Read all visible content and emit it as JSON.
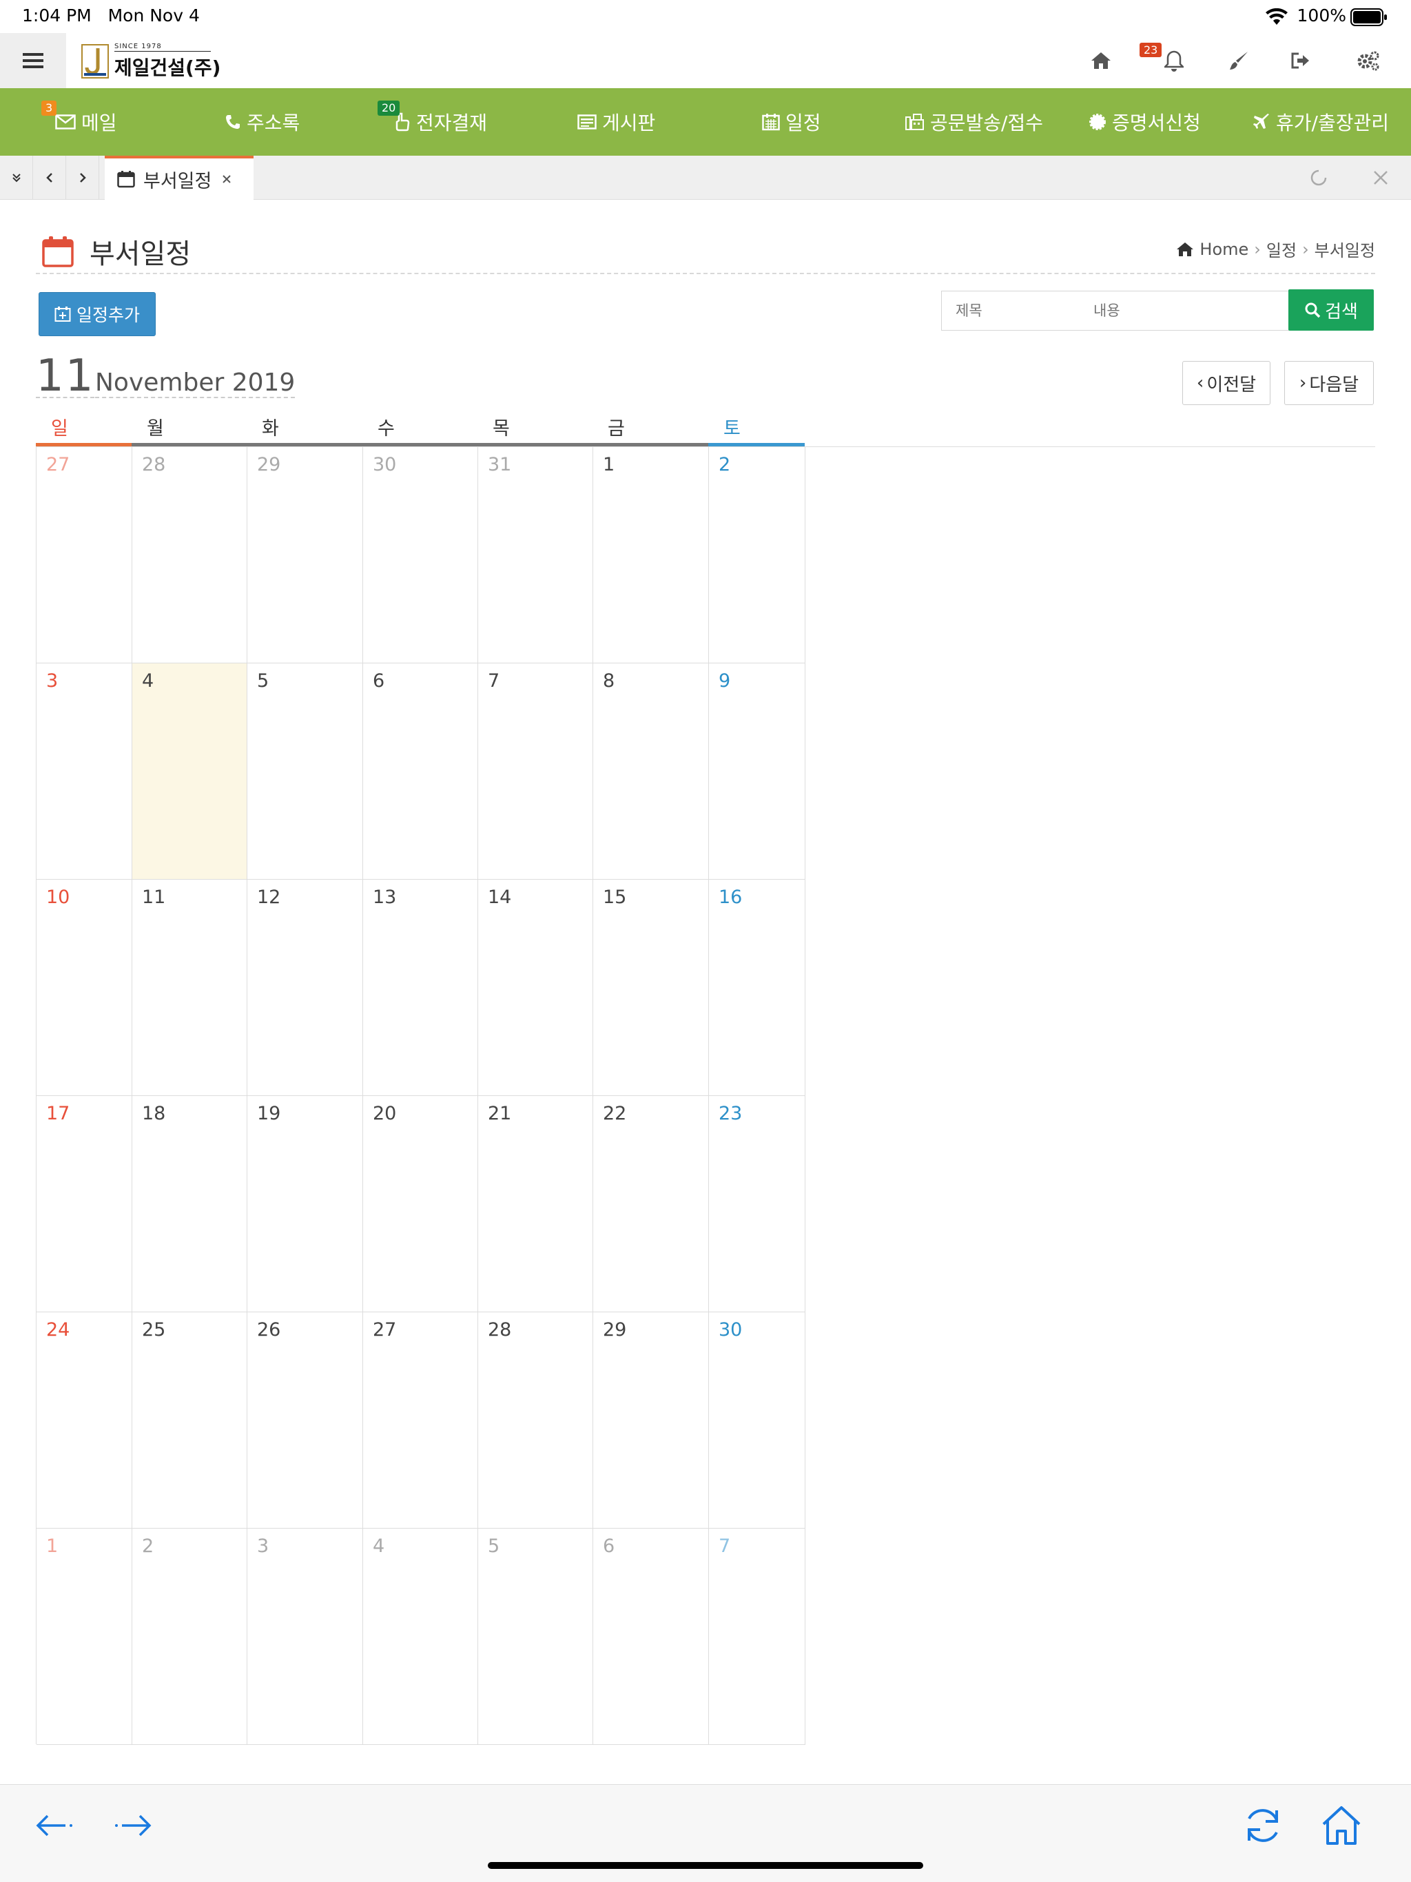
{
  "status_bar": {
    "time": "1:04 PM",
    "date": "Mon Nov 4",
    "battery": "100%"
  },
  "header": {
    "logo_since": "SINCE 1978",
    "logo_name": "제일건설(주)",
    "notification_count": "23"
  },
  "nav": {
    "items": [
      {
        "label": "메일",
        "icon": "mail-icon",
        "badge": "3",
        "badge_color": "#f08c1e"
      },
      {
        "label": "주소록",
        "icon": "phone-icon"
      },
      {
        "label": "전자결재",
        "icon": "approval-icon",
        "badge": "20",
        "badge_color": "#1a8a3c"
      },
      {
        "label": "게시판",
        "icon": "board-icon"
      },
      {
        "label": "일정",
        "icon": "calendar-icon"
      },
      {
        "label": "공문발송/접수",
        "icon": "fax-icon"
      },
      {
        "label": "증명서신청",
        "icon": "certificate-icon"
      },
      {
        "label": "휴가/출장관리",
        "icon": "plane-icon"
      }
    ]
  },
  "tabs": {
    "active_label": "부서일정"
  },
  "page": {
    "title": "부서일정",
    "breadcrumb": [
      "Home",
      "일정",
      "부서일정"
    ],
    "add_button": "일정추가",
    "search_title_placeholder": "제목",
    "search_content_placeholder": "내용",
    "search_button": "검색",
    "month_number": "11",
    "month_name": "November 2019",
    "prev_button": "이전달",
    "next_button": "다음달"
  },
  "calendar": {
    "weekdays": [
      "일",
      "월",
      "화",
      "수",
      "목",
      "금",
      "토"
    ],
    "today": "4",
    "weeks": [
      [
        {
          "d": "27",
          "o": true
        },
        {
          "d": "28",
          "o": true
        },
        {
          "d": "29",
          "o": true
        },
        {
          "d": "30",
          "o": true
        },
        {
          "d": "31",
          "o": true
        },
        {
          "d": "1"
        },
        {
          "d": "2"
        }
      ],
      [
        {
          "d": "3"
        },
        {
          "d": "4",
          "t": true
        },
        {
          "d": "5"
        },
        {
          "d": "6"
        },
        {
          "d": "7"
        },
        {
          "d": "8"
        },
        {
          "d": "9"
        }
      ],
      [
        {
          "d": "10"
        },
        {
          "d": "11"
        },
        {
          "d": "12"
        },
        {
          "d": "13"
        },
        {
          "d": "14"
        },
        {
          "d": "15"
        },
        {
          "d": "16"
        }
      ],
      [
        {
          "d": "17"
        },
        {
          "d": "18"
        },
        {
          "d": "19"
        },
        {
          "d": "20"
        },
        {
          "d": "21"
        },
        {
          "d": "22"
        },
        {
          "d": "23"
        }
      ],
      [
        {
          "d": "24"
        },
        {
          "d": "25"
        },
        {
          "d": "26"
        },
        {
          "d": "27"
        },
        {
          "d": "28"
        },
        {
          "d": "29"
        },
        {
          "d": "30"
        }
      ],
      [
        {
          "d": "1",
          "o": true
        },
        {
          "d": "2",
          "o": true
        },
        {
          "d": "3",
          "o": true
        },
        {
          "d": "4",
          "o": true
        },
        {
          "d": "5",
          "o": true
        },
        {
          "d": "6",
          "o": true
        },
        {
          "d": "7",
          "o": true
        }
      ]
    ]
  },
  "colors": {
    "nav_bg": "#8cb746",
    "tab_accent": "#e8703a",
    "add_button": "#3a8fc9",
    "search_button": "#1aa35b",
    "sunday": "#e8503a",
    "saturday": "#2d90c9",
    "today_bg": "#fcf7e4"
  }
}
